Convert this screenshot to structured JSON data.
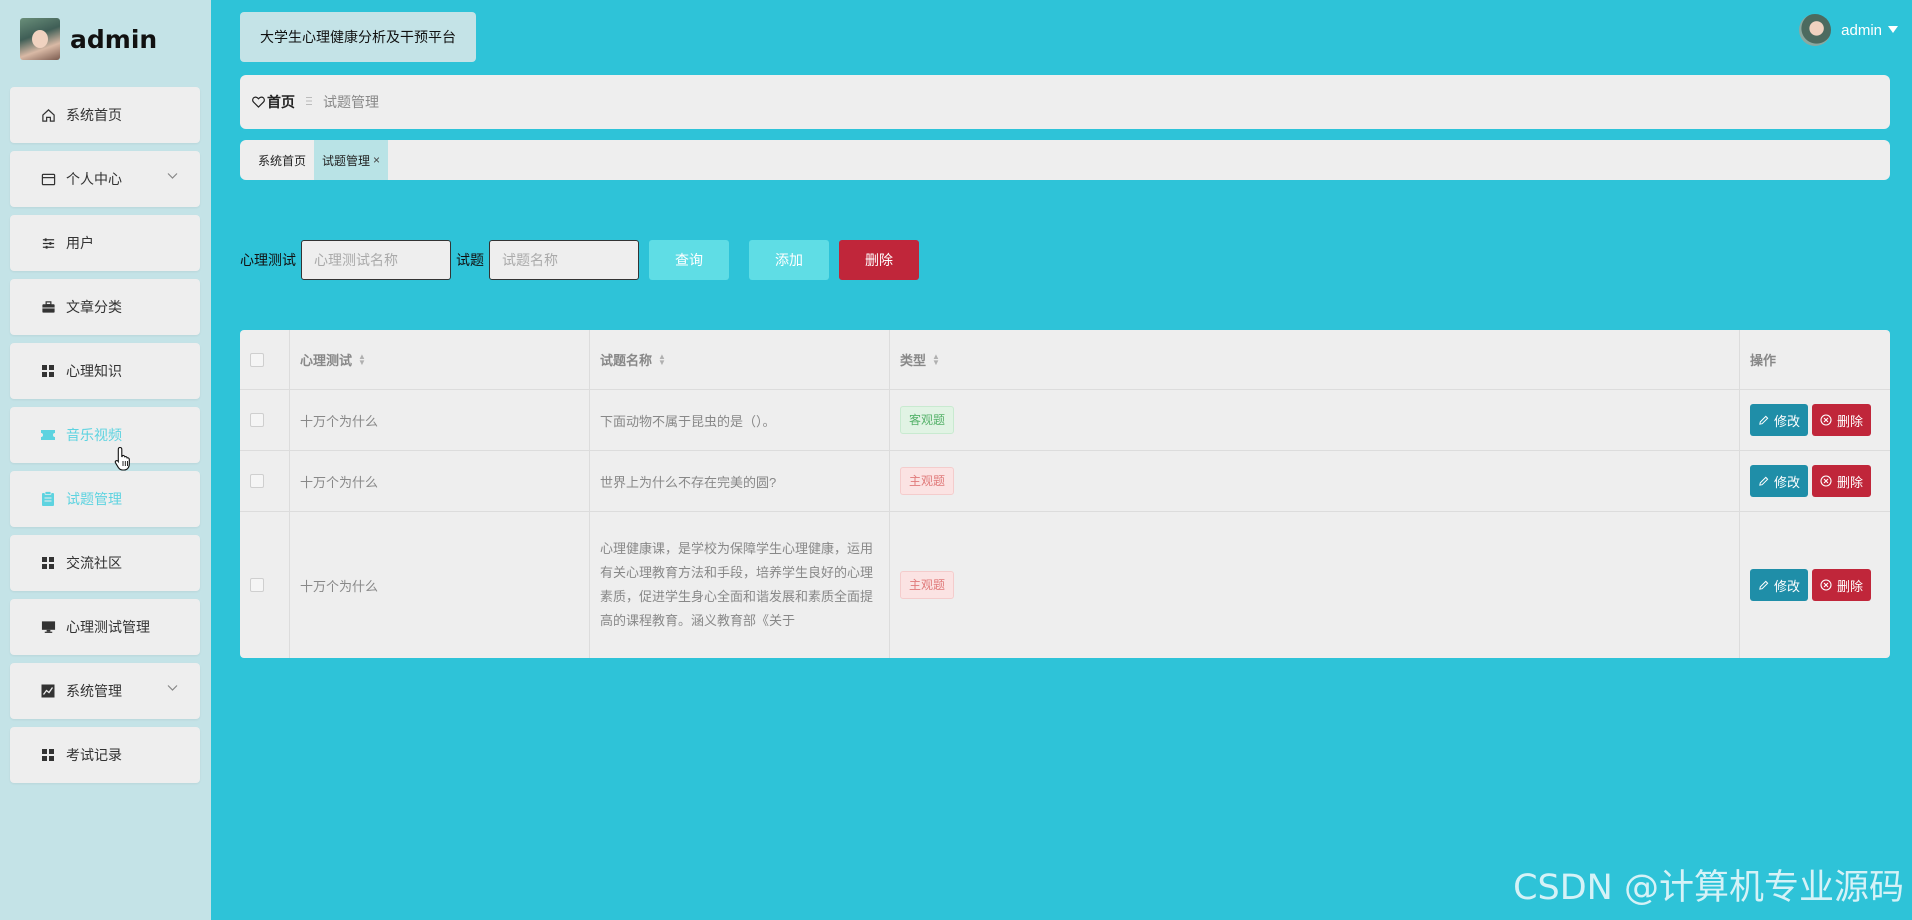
{
  "sidebar": {
    "brand": "admin",
    "items": [
      {
        "label": "系统首页",
        "icon": "home-icon"
      },
      {
        "label": "个人中心",
        "icon": "card-icon",
        "caret": true
      },
      {
        "label": "用户",
        "icon": "sliders-icon"
      },
      {
        "label": "文章分类",
        "icon": "briefcase-icon"
      },
      {
        "label": "心理知识",
        "icon": "grid-icon"
      },
      {
        "label": "音乐视频",
        "icon": "ticket-icon",
        "highlight": true
      },
      {
        "label": "试题管理",
        "icon": "clipboard-icon",
        "highlight": true
      },
      {
        "label": "交流社区",
        "icon": "grid-icon"
      },
      {
        "label": "心理测试管理",
        "icon": "monitor-icon"
      },
      {
        "label": "系统管理",
        "icon": "chart-icon",
        "caret": true
      },
      {
        "label": "考试记录",
        "icon": "grid-icon"
      }
    ]
  },
  "header": {
    "platform_title": "大学生心理健康分析及干预平台",
    "user_name": "admin"
  },
  "breadcrumb": {
    "home": "首页",
    "current": "试题管理"
  },
  "tabs": [
    {
      "label": "系统首页",
      "active": false
    },
    {
      "label": "试题管理",
      "active": true,
      "close": "×"
    }
  ],
  "search": {
    "test_label": "心理测试",
    "test_placeholder": "心理测试名称",
    "question_label": "试题",
    "question_placeholder": "试题名称",
    "query_button": "查询",
    "add_button": "添加",
    "delete_button": "删除"
  },
  "table": {
    "columns": [
      "心理测试",
      "试题名称",
      "类型",
      "操作"
    ],
    "rows": [
      {
        "test": "十万个为什么",
        "question": "下面动物不属于昆虫的是（）。",
        "type": "客观题",
        "type_kind": "objective"
      },
      {
        "test": "十万个为什么",
        "question": "世界上为什么不存在完美的圆?",
        "type": "主观题",
        "type_kind": "subjective"
      },
      {
        "test": "十万个为什么",
        "question": "心理健康课，是学校为保障学生心理健康，运用有关心理教育方法和手段，培养学生良好的心理素质，促进学生身心全面和谐发展和素质全面提高的课程教育。涵义教育部《关于",
        "type": "主观题",
        "type_kind": "subjective"
      }
    ],
    "edit_label": "修改",
    "delete_label": "删除"
  },
  "watermark": "CSDN @计算机专业源码",
  "colors": {
    "background": "#2ec3d8",
    "sidebar": "#c4e3e7",
    "panel": "#eeeeee",
    "danger": "#c0263a",
    "edit": "#1f8ea8",
    "light_button": "#5fdde5"
  }
}
